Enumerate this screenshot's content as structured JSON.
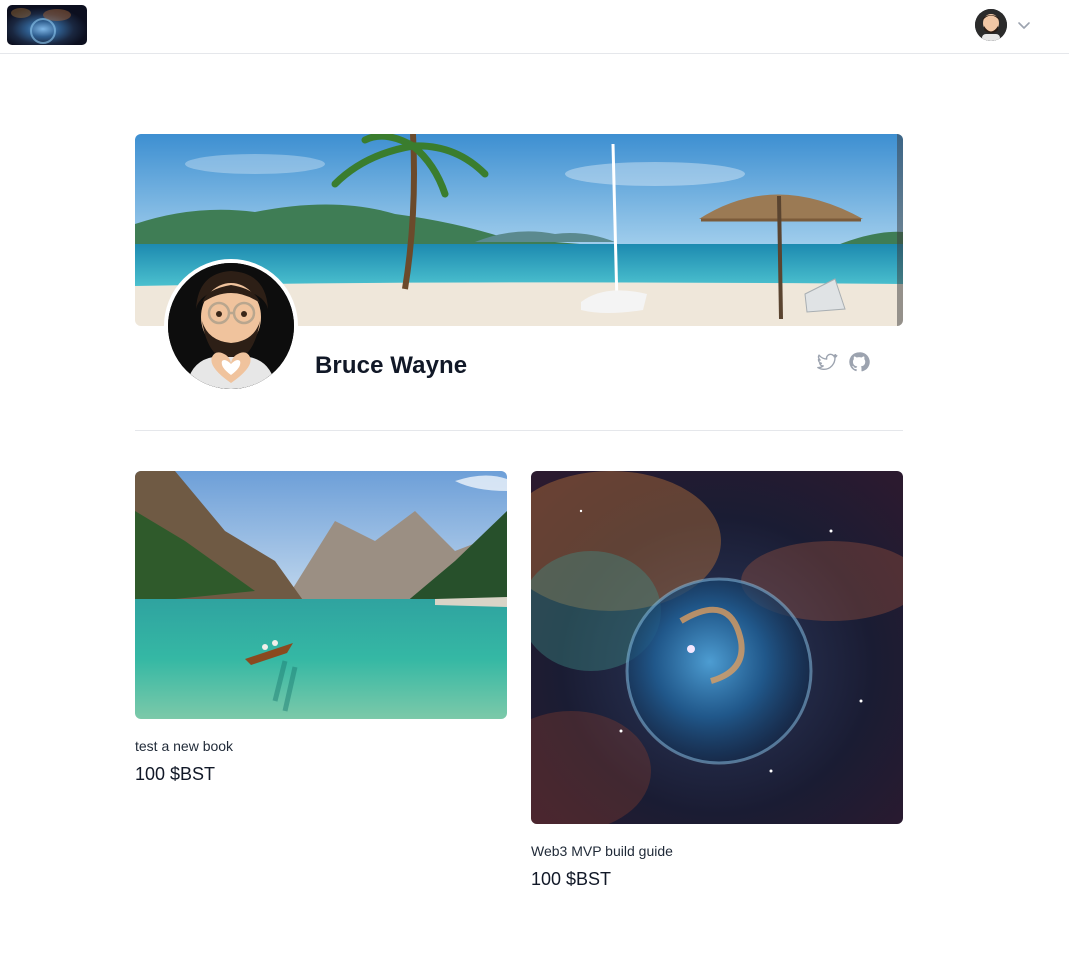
{
  "header": {
    "logo_icon": "nebula-thumbnail-logo",
    "user_avatar_icon": "memoji-avatar",
    "menu_icon": "chevron-down-icon"
  },
  "profile": {
    "banner_image": "beach-with-palm-trees-and-umbrella",
    "avatar_image": "bearded-memoji-heart-hands",
    "name": "Bruce Wayne",
    "social_icons": [
      "twitter-icon",
      "github-icon"
    ]
  },
  "colors": {
    "text_primary": "#111827",
    "divider": "#e5e7eb",
    "icon_gray": "#9ca3af"
  },
  "items": [
    {
      "title": "test a new book",
      "price": "100 $BST",
      "image": "mountain-lake-with-rowboat"
    },
    {
      "title": "Web3 MVP build guide",
      "price": "100 $BST",
      "image": "space-nebula-bubble"
    }
  ]
}
